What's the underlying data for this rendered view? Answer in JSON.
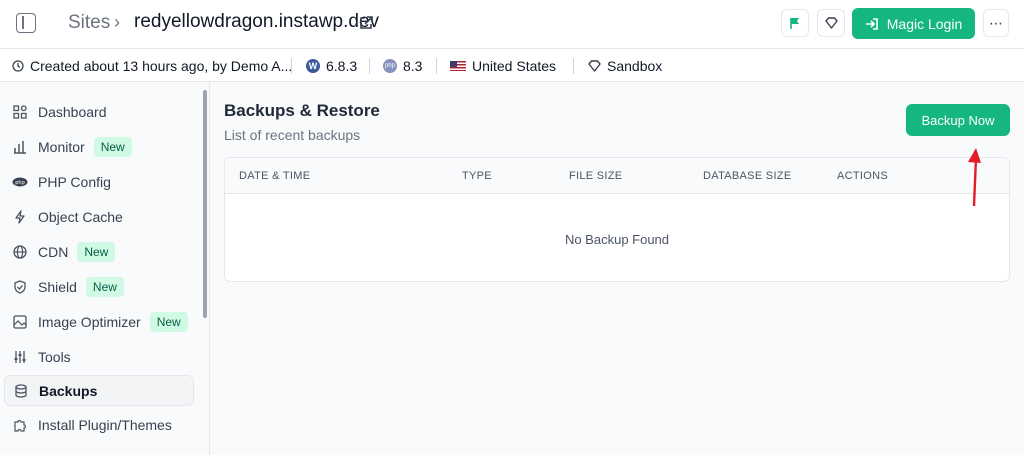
{
  "header": {
    "breadcrumb_root": "Sites",
    "breadcrumb_sep": "›",
    "site_name": "redyellowdragon.instawp.dev",
    "magic_login": "Magic Login",
    "more": "⋯"
  },
  "info": {
    "created": "Created about 13 hours ago, by Demo A...",
    "wp_version": "6.8.3",
    "php_version": "8.3",
    "region": "United States",
    "plan": "Sandbox"
  },
  "sidebar": {
    "items": [
      {
        "label": "Dashboard",
        "icon": "grid-icon",
        "badge": ""
      },
      {
        "label": "Monitor",
        "icon": "bar-chart-icon",
        "badge": "New"
      },
      {
        "label": "PHP Config",
        "icon": "php-icon",
        "badge": ""
      },
      {
        "label": "Object Cache",
        "icon": "bolt-icon",
        "badge": ""
      },
      {
        "label": "CDN",
        "icon": "globe-icon",
        "badge": "New"
      },
      {
        "label": "Shield",
        "icon": "shield-icon",
        "badge": "New"
      },
      {
        "label": "Image Optimizer",
        "icon": "image-icon",
        "badge": "New"
      },
      {
        "label": "Tools",
        "icon": "sliders-icon",
        "badge": ""
      },
      {
        "label": "Backups",
        "icon": "database-icon",
        "badge": ""
      },
      {
        "label": "Install Plugin/Themes",
        "icon": "puzzle-icon",
        "badge": ""
      }
    ]
  },
  "main": {
    "title": "Backups & Restore",
    "subtitle": "List of recent backups",
    "backup_button": "Backup Now",
    "columns": [
      "DATE & TIME",
      "TYPE",
      "FILE SIZE",
      "DATABASE SIZE",
      "ACTIONS"
    ],
    "empty_message": "No Backup Found"
  },
  "colors": {
    "accent": "#15b77e",
    "arrow": "#e11d28"
  }
}
